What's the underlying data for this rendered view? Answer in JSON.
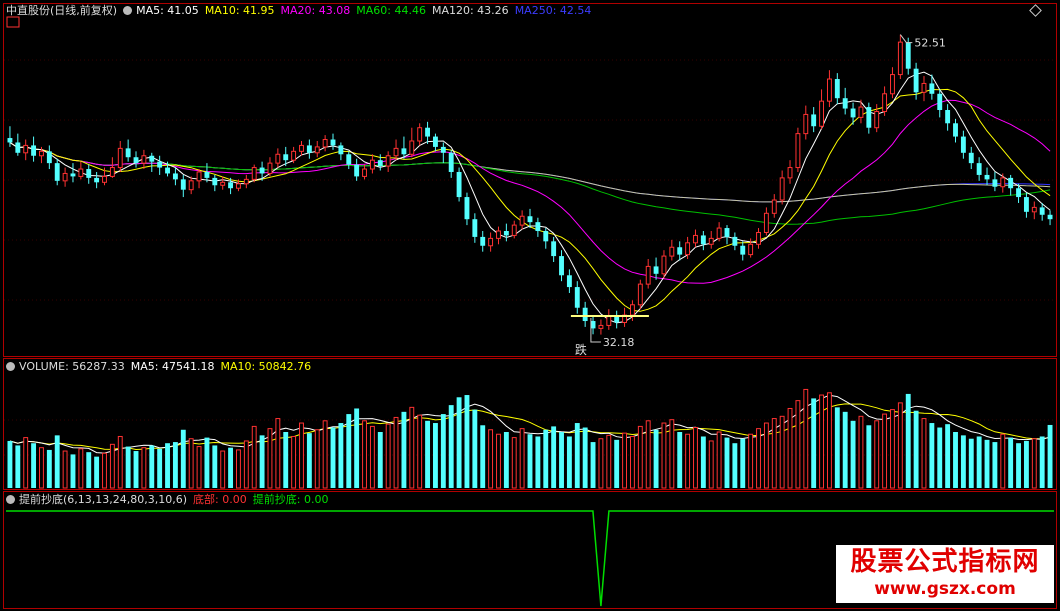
{
  "header": {
    "stock_name": "中直股份",
    "period": "(日线,前复权)",
    "ma5": "MA5: 41.05",
    "ma10": "MA10: 41.95",
    "ma20": "MA20: 43.08",
    "ma60": "MA60: 44.46",
    "ma120": "MA120: 43.26",
    "ma250": "MA250: 42.54"
  },
  "volume_header": {
    "label": "VOLUME: 56287.33",
    "ma5": "MA5: 47541.18",
    "ma10": "MA10: 50842.76"
  },
  "indicator_header": {
    "label": "提前抄底(6,13,13,24,80,3,10,6)",
    "bottom": "底部: 0.00",
    "early": "提前抄底: 0.00"
  },
  "annotations": {
    "high": "52.51",
    "low": "32.18",
    "fall_mark": "跌"
  },
  "watermark": {
    "title": "股票公式指标网",
    "url": "www.gszx.com"
  },
  "colors": {
    "up": "#ff3232",
    "down": "#54ffff",
    "ma5": "#ffffff",
    "ma10": "#ffff00",
    "ma20": "#ff00ff",
    "ma60": "#00c000",
    "ma120": "#c8c8a0",
    "ma250": "#3232ff",
    "border": "#b00000",
    "indicator": "#00dd00"
  },
  "chart_data": {
    "type": "candlestick",
    "price_range": [
      31.0,
      53.5
    ],
    "high": 52.51,
    "low": 32.18,
    "candles": [
      [
        45.5,
        45.2,
        46.3,
        44.9
      ],
      [
        45.2,
        44.5,
        45.8,
        44.3
      ],
      [
        44.5,
        45.0,
        45.4,
        44.0
      ],
      [
        45.0,
        44.3,
        45.6,
        43.9
      ],
      [
        44.3,
        44.6,
        44.9,
        43.8
      ],
      [
        44.6,
        43.8,
        45.0,
        43.4
      ],
      [
        43.8,
        42.6,
        44.1,
        42.3
      ],
      [
        42.6,
        43.1,
        43.5,
        42.2
      ],
      [
        43.1,
        42.9,
        43.8,
        42.5
      ],
      [
        42.9,
        43.4,
        43.9,
        42.7
      ],
      [
        43.4,
        42.8,
        43.7,
        42.4
      ],
      [
        42.8,
        42.5,
        43.2,
        42.1
      ],
      [
        42.5,
        42.9,
        43.5,
        42.3
      ],
      [
        42.9,
        43.5,
        44.2,
        42.8
      ],
      [
        43.5,
        44.8,
        45.3,
        43.2
      ],
      [
        44.8,
        44.2,
        45.4,
        43.9
      ],
      [
        44.2,
        43.8,
        44.6,
        43.5
      ],
      [
        43.8,
        44.3,
        44.7,
        43.4
      ],
      [
        44.3,
        43.9,
        44.5,
        43.2
      ],
      [
        43.9,
        43.5,
        44.3,
        43.0
      ],
      [
        43.5,
        43.1,
        43.9,
        42.9
      ],
      [
        43.1,
        42.7,
        43.5,
        42.3
      ],
      [
        42.7,
        42.0,
        43.0,
        41.5
      ],
      [
        42.0,
        42.6,
        42.9,
        41.7
      ],
      [
        42.6,
        43.2,
        43.4,
        42.1
      ],
      [
        43.2,
        42.8,
        43.8,
        42.5
      ],
      [
        42.8,
        42.3,
        43.0,
        41.9
      ],
      [
        42.3,
        42.5,
        42.9,
        42.0
      ],
      [
        42.5,
        42.1,
        42.8,
        41.7
      ],
      [
        42.1,
        42.4,
        42.7,
        41.9
      ],
      [
        42.4,
        42.7,
        43.0,
        42.1
      ],
      [
        42.7,
        43.5,
        43.7,
        42.5
      ],
      [
        43.5,
        43.1,
        43.9,
        42.6
      ],
      [
        43.1,
        43.8,
        44.2,
        42.9
      ],
      [
        43.8,
        44.4,
        44.8,
        43.5
      ],
      [
        44.4,
        44.0,
        44.9,
        43.6
      ],
      [
        44.0,
        44.6,
        44.9,
        43.8
      ],
      [
        44.6,
        45.0,
        45.3,
        44.3
      ],
      [
        45.0,
        44.5,
        45.4,
        44.1
      ],
      [
        44.5,
        44.9,
        45.3,
        44.2
      ],
      [
        44.9,
        45.4,
        45.7,
        44.6
      ],
      [
        45.4,
        45.0,
        45.8,
        44.7
      ],
      [
        45.0,
        44.4,
        45.2,
        44.0
      ],
      [
        44.4,
        43.7,
        44.6,
        43.4
      ],
      [
        43.7,
        42.9,
        44.1,
        42.6
      ],
      [
        42.9,
        43.4,
        43.7,
        42.7
      ],
      [
        43.4,
        44.0,
        44.4,
        43.1
      ],
      [
        44.0,
        43.6,
        44.4,
        43.3
      ],
      [
        43.6,
        44.3,
        44.6,
        43.2
      ],
      [
        44.3,
        44.8,
        45.4,
        44.0
      ],
      [
        44.8,
        44.4,
        45.6,
        44.1
      ],
      [
        44.4,
        45.3,
        46.2,
        44.2
      ],
      [
        45.3,
        46.2,
        46.5,
        45.0
      ],
      [
        46.2,
        45.6,
        46.6,
        45.1
      ],
      [
        45.6,
        44.9,
        45.8,
        44.6
      ],
      [
        44.9,
        44.5,
        45.2,
        43.8
      ],
      [
        44.5,
        43.2,
        44.7,
        42.8
      ],
      [
        43.2,
        41.5,
        43.5,
        41.2
      ],
      [
        41.5,
        40.0,
        41.8,
        39.6
      ],
      [
        40.0,
        38.8,
        40.4,
        38.4
      ],
      [
        38.8,
        38.2,
        39.2,
        37.8
      ],
      [
        38.2,
        38.7,
        39.1,
        37.8
      ],
      [
        38.7,
        39.2,
        39.5,
        38.3
      ],
      [
        39.2,
        38.9,
        39.7,
        38.5
      ],
      [
        38.9,
        39.6,
        39.9,
        38.7
      ],
      [
        39.6,
        40.2,
        40.6,
        39.3
      ],
      [
        40.2,
        39.8,
        40.7,
        39.4
      ],
      [
        39.8,
        39.2,
        40.1,
        38.8
      ],
      [
        39.2,
        38.5,
        39.4,
        38.0
      ],
      [
        38.5,
        37.5,
        38.8,
        37.1
      ],
      [
        37.5,
        36.2,
        37.9,
        35.8
      ],
      [
        36.2,
        35.4,
        36.6,
        35.0
      ],
      [
        35.4,
        34.0,
        35.8,
        33.6
      ],
      [
        34.0,
        33.1,
        34.4,
        32.7
      ],
      [
        33.1,
        32.6,
        33.5,
        32.2
      ],
      [
        32.6,
        32.8,
        33.2,
        32.18
      ],
      [
        32.8,
        33.4,
        33.9,
        32.5
      ],
      [
        33.4,
        33.0,
        33.8,
        32.6
      ],
      [
        33.0,
        33.5,
        34.0,
        32.7
      ],
      [
        33.5,
        34.2,
        34.5,
        33.1
      ],
      [
        34.2,
        35.6,
        35.9,
        33.9
      ],
      [
        35.6,
        36.8,
        37.3,
        35.3
      ],
      [
        36.8,
        36.3,
        37.4,
        35.9
      ],
      [
        36.3,
        37.5,
        37.9,
        36.0
      ],
      [
        37.5,
        38.1,
        38.6,
        37.2
      ],
      [
        38.1,
        37.6,
        38.5,
        37.2
      ],
      [
        37.6,
        38.4,
        38.8,
        37.3
      ],
      [
        38.4,
        38.9,
        39.3,
        38.1
      ],
      [
        38.9,
        38.3,
        39.2,
        37.9
      ],
      [
        38.3,
        38.7,
        39.2,
        38.0
      ],
      [
        38.7,
        39.4,
        39.8,
        38.5
      ],
      [
        39.4,
        38.8,
        39.6,
        38.3
      ],
      [
        38.8,
        38.2,
        39.1,
        37.9
      ],
      [
        38.2,
        37.6,
        38.5,
        37.2
      ],
      [
        37.6,
        38.3,
        38.7,
        37.4
      ],
      [
        38.3,
        39.1,
        39.4,
        38.0
      ],
      [
        39.1,
        40.4,
        40.8,
        38.9
      ],
      [
        40.4,
        41.3,
        41.7,
        40.1
      ],
      [
        41.3,
        42.8,
        43.3,
        41.0
      ],
      [
        42.8,
        43.5,
        44.0,
        42.4
      ],
      [
        43.5,
        45.8,
        46.2,
        43.2
      ],
      [
        45.8,
        47.1,
        47.7,
        45.4
      ],
      [
        47.1,
        46.3,
        47.6,
        45.9
      ],
      [
        46.3,
        48.0,
        48.8,
        46.1
      ],
      [
        48.0,
        49.5,
        50.1,
        47.6
      ],
      [
        49.5,
        48.2,
        49.9,
        47.8
      ],
      [
        48.2,
        47.5,
        48.9,
        47.1
      ],
      [
        47.5,
        46.9,
        47.9,
        46.4
      ],
      [
        46.9,
        47.6,
        48.1,
        46.5
      ],
      [
        47.6,
        46.2,
        47.9,
        45.8
      ],
      [
        46.2,
        47.3,
        47.8,
        45.9
      ],
      [
        47.3,
        48.5,
        49.0,
        47.0
      ],
      [
        48.5,
        49.8,
        50.3,
        48.2
      ],
      [
        49.8,
        52.0,
        52.51,
        49.5
      ],
      [
        52.0,
        50.2,
        52.3,
        49.8
      ],
      [
        50.2,
        48.6,
        50.6,
        48.1
      ],
      [
        48.6,
        49.2,
        49.7,
        48.0
      ],
      [
        49.2,
        48.5,
        49.8,
        48.1
      ],
      [
        48.5,
        47.4,
        48.8,
        46.9
      ],
      [
        47.4,
        46.5,
        47.8,
        46.0
      ],
      [
        46.5,
        45.6,
        46.8,
        45.2
      ],
      [
        45.6,
        44.5,
        46.0,
        44.1
      ],
      [
        44.5,
        43.8,
        44.9,
        43.4
      ],
      [
        43.8,
        43.0,
        44.2,
        42.6
      ],
      [
        43.0,
        42.7,
        43.5,
        42.3
      ],
      [
        42.7,
        42.2,
        43.2,
        41.9
      ],
      [
        42.2,
        42.8,
        43.1,
        41.8
      ],
      [
        42.8,
        42.1,
        43.0,
        41.6
      ],
      [
        42.1,
        41.5,
        42.4,
        41.1
      ],
      [
        41.5,
        40.5,
        41.8,
        40.1
      ],
      [
        40.5,
        40.8,
        41.2,
        40.0
      ],
      [
        40.8,
        40.3,
        41.1,
        39.9
      ],
      [
        40.3,
        40.0,
        40.6,
        39.6
      ]
    ],
    "volume_range": [
      0,
      100000
    ],
    "last_volume": 56287.33,
    "volumes": [
      42000,
      38000,
      45000,
      40000,
      36000,
      34000,
      47000,
      33000,
      30000,
      35000,
      32000,
      28000,
      31000,
      39000,
      46000,
      37000,
      33000,
      36000,
      38000,
      35000,
      40000,
      41000,
      52000,
      44000,
      37000,
      45000,
      38000,
      33000,
      36000,
      34000,
      42000,
      55000,
      47000,
      53000,
      62000,
      50000,
      46000,
      58000,
      49000,
      52000,
      60000,
      54000,
      58000,
      66000,
      71000,
      60000,
      55000,
      50000,
      57000,
      63000,
      68000,
      72000,
      65000,
      60000,
      58000,
      66000,
      74000,
      81000,
      83000,
      70000,
      56000,
      52000,
      48000,
      50000,
      45000,
      53000,
      48000,
      46000,
      52000,
      55000,
      50000,
      46000,
      58000,
      54000,
      41000,
      44000,
      47000,
      43000,
      49000,
      46000,
      55000,
      60000,
      52000,
      58000,
      61000,
      50000,
      48000,
      54000,
      46000,
      42000,
      50000,
      45000,
      40000,
      44000,
      48000,
      53000,
      58000,
      62000,
      64000,
      71000,
      78000,
      88000,
      80000,
      83000,
      85000,
      72000,
      68000,
      60000,
      64000,
      56000,
      60000,
      66000,
      70000,
      76000,
      84000,
      69000,
      62000,
      58000,
      54000,
      57000,
      50000,
      47000,
      44000,
      46000,
      43000,
      41000,
      48000,
      45000,
      40000,
      42000,
      44000,
      46000,
      56287
    ],
    "indicator": {
      "name": "提前抄底",
      "params": [
        6,
        13,
        13,
        24,
        80,
        3,
        10,
        6
      ],
      "bottom_value": 0.0,
      "early_value": 0.0
    }
  }
}
